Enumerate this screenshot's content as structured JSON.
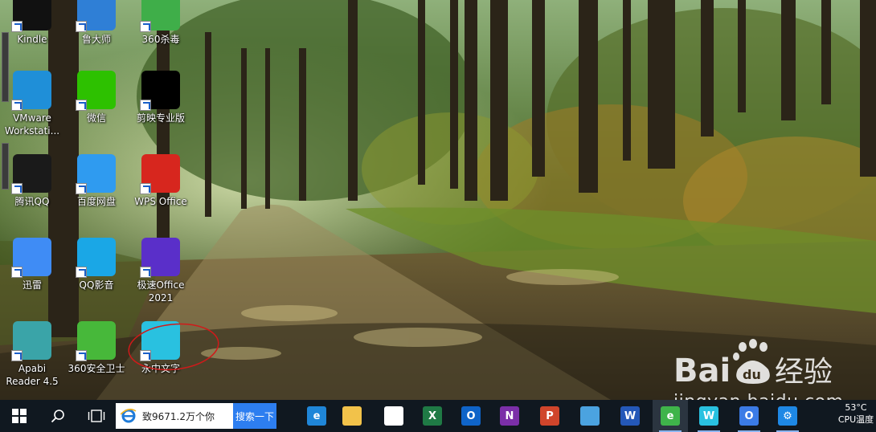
{
  "desktop": {
    "icons": [
      {
        "label": "Kindle",
        "icon": "kindle-icon",
        "color": "#111111"
      },
      {
        "label": "鲁大师",
        "icon": "ludashi-icon",
        "color": "#2f7fd6"
      },
      {
        "label": "360杀毒",
        "icon": "360-antivirus-icon",
        "color": "#3fae49"
      },
      {
        "label": "VMware\nWorkstati...",
        "icon": "vmware-icon",
        "color": "#1f8fd8"
      },
      {
        "label": "微信",
        "icon": "wechat-icon",
        "color": "#2dc100"
      },
      {
        "label": "剪映专业版",
        "icon": "capcut-icon",
        "color": "#000000"
      },
      {
        "label": "腾讯QQ",
        "icon": "qq-icon",
        "color": "#1a1a1a"
      },
      {
        "label": "百度网盘",
        "icon": "baidu-netdisk-icon",
        "color": "#2f9bf0"
      },
      {
        "label": "WPS Office",
        "icon": "wps-icon",
        "color": "#d7261e"
      },
      {
        "label": "迅雷",
        "icon": "thunder-icon",
        "color": "#3f8cf5"
      },
      {
        "label": "QQ影音",
        "icon": "qq-player-icon",
        "color": "#1aa7e6"
      },
      {
        "label": "极速Office\n2021",
        "icon": "jisu-office-icon",
        "color": "#5a2fc9"
      },
      {
        "label": "Apabi\nReader 4.5",
        "icon": "apabi-reader-icon",
        "color": "#3aa4a8"
      },
      {
        "label": "360安全卫士",
        "icon": "360-security-icon",
        "color": "#47b83a"
      },
      {
        "label": "永中文字",
        "icon": "yozo-writer-icon",
        "color": "#29c1e0"
      }
    ]
  },
  "watermark": {
    "text": "jingyan.baidu.com",
    "brand": "Bai du 经验"
  },
  "taskbar": {
    "search_text": "致9671.2万个你",
    "search_button": "搜索一下",
    "apps": [
      {
        "icon": "edge-icon",
        "color": "#1f86d8",
        "glyph": "e"
      },
      {
        "icon": "file-explorer-icon",
        "color": "#f2c24a",
        "glyph": ""
      },
      {
        "icon": "store-icon",
        "color": "#ffffff",
        "glyph": ""
      },
      {
        "icon": "excel-icon",
        "color": "#1f7a45",
        "glyph": "X"
      },
      {
        "icon": "outlook-icon",
        "color": "#0f64c8",
        "glyph": "O"
      },
      {
        "icon": "onenote-icon",
        "color": "#7b2fa8",
        "glyph": "N"
      },
      {
        "icon": "powerpoint-icon",
        "color": "#d0452b",
        "glyph": "P"
      },
      {
        "icon": "paint-icon",
        "color": "#4ba3e0",
        "glyph": ""
      },
      {
        "icon": "word-icon",
        "color": "#2458b8",
        "glyph": "W"
      },
      {
        "icon": "360-browser-icon",
        "color": "#3fb44a",
        "glyph": "e"
      },
      {
        "icon": "yozo-writer-icon",
        "color": "#29c1e0",
        "glyph": "W"
      },
      {
        "icon": "jisu-o-icon",
        "color": "#3b7be6",
        "glyph": "O"
      },
      {
        "icon": "settings-gear-icon",
        "color": "#1e88e5",
        "glyph": "⚙"
      }
    ],
    "tray": {
      "temperature": "53°C",
      "cpu_label": "CPU温度"
    }
  }
}
